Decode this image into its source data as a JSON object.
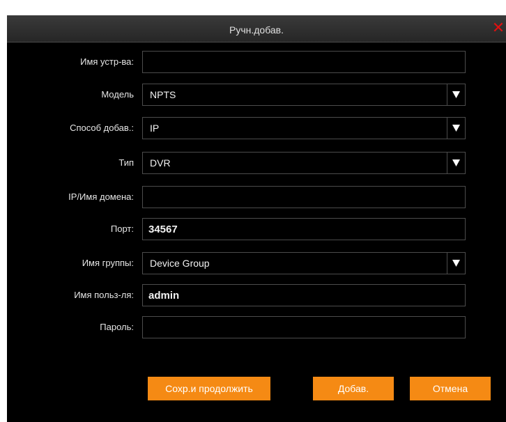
{
  "dialog": {
    "title": "Ручн.добав.",
    "close_icon": "close-icon"
  },
  "form": {
    "device_name": {
      "label": "Имя устр-ва:",
      "value": ""
    },
    "model": {
      "label": "Модель",
      "value": "NPTS"
    },
    "add_method": {
      "label": "Способ добав.:",
      "value": "IP"
    },
    "type": {
      "label": "Тип",
      "value": "DVR"
    },
    "ip_domain": {
      "label": "IP/Имя домена:",
      "value": ""
    },
    "port": {
      "label": "Порт:",
      "value": "34567"
    },
    "group": {
      "label": "Имя группы:",
      "value": "Device Group"
    },
    "username": {
      "label": "Имя польз-ля:",
      "value": "admin"
    },
    "password": {
      "label": "Пароль:",
      "value": ""
    }
  },
  "buttons": {
    "save_continue": "Сохр.и продолжить",
    "add": "Добав.",
    "cancel": "Отмена"
  },
  "colors": {
    "accent": "#f58a14",
    "close": "#e01010",
    "background": "#000000"
  }
}
